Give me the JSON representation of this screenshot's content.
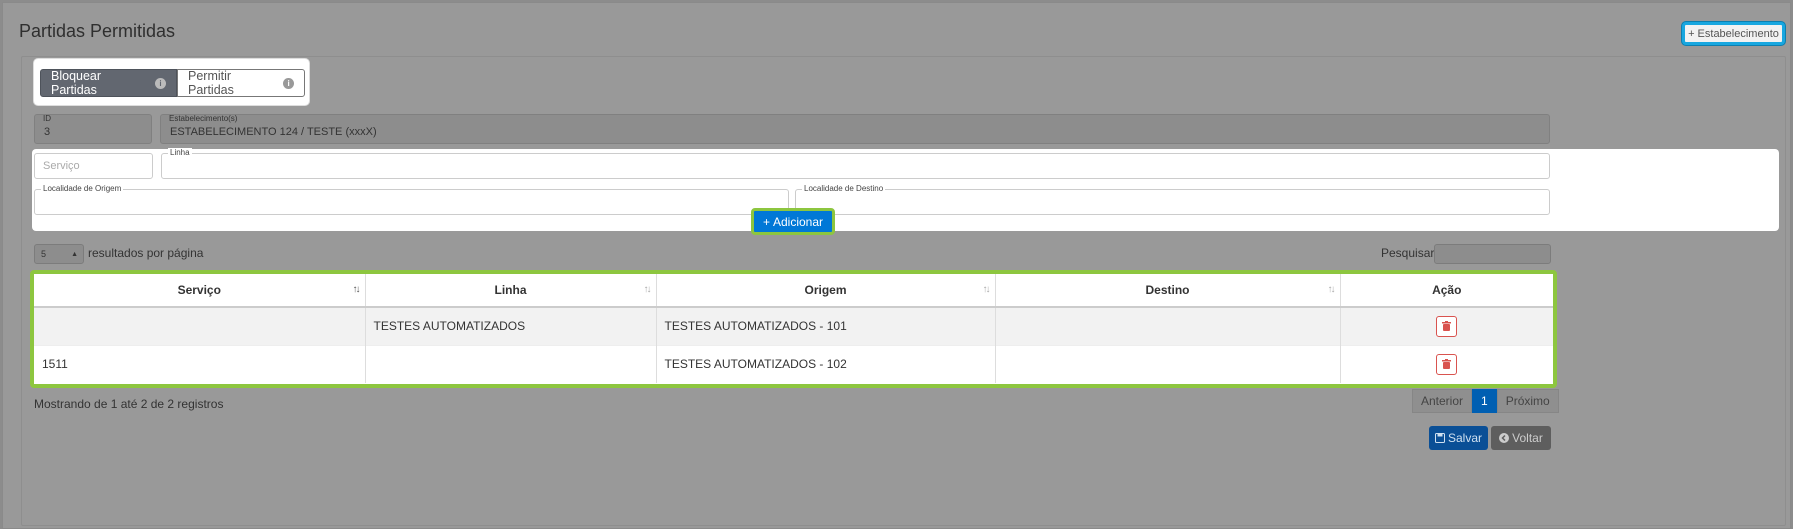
{
  "page": {
    "title": "Partidas Permitidas"
  },
  "header": {
    "add_establishment_label": "Estabelecimento",
    "add_icon": "+"
  },
  "tabs": [
    {
      "label": "Bloquear Partidas",
      "active": true
    },
    {
      "label": "Permitir Partidas",
      "active": false
    }
  ],
  "readonly": {
    "id_label": "ID",
    "id_value": "3",
    "estab_label": "Estabelecimento(s)",
    "estab_value": "ESTABELECIMENTO 124 / TESTE (xxxX)"
  },
  "form": {
    "servico_placeholder": "Serviço",
    "linha_label": "Linha",
    "origem_label": "Localidade de Origem",
    "destino_label": "Localidade de Destino",
    "add_button_label": "Adicionar"
  },
  "datatable": {
    "page_length": "5",
    "length_text": "resultados por página",
    "search_label": "Pesquisar",
    "columns": [
      "Serviço",
      "Linha",
      "Origem",
      "Destino",
      "Ação"
    ],
    "rows": [
      {
        "servico": "",
        "linha": "TESTES AUTOMATIZADOS",
        "origem": "TESTES AUTOMATIZADOS - 101",
        "destino": ""
      },
      {
        "servico": "1511",
        "linha": "",
        "origem": "TESTES AUTOMATIZADOS - 102",
        "destino": ""
      }
    ],
    "info": "Mostrando de 1 até 2 de 2 registros",
    "pager": {
      "prev": "Anterior",
      "current": "1",
      "next": "Próximo"
    }
  },
  "footer": {
    "save_label": "Salvar",
    "back_label": "Voltar"
  },
  "colors": {
    "primary": "#0078d7",
    "highlight_green": "#8dc63f",
    "highlight_blue": "#18a7e0",
    "danger": "#d9534f"
  }
}
